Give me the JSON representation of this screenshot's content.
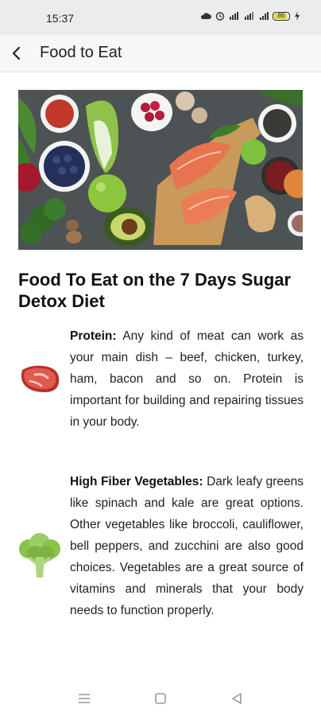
{
  "status_bar": {
    "time": "15:37",
    "battery": "86",
    "icons": [
      "cloud-icon",
      "alarm-icon",
      "hd-signal-icon",
      "wifi-signal-icon",
      "cell-signal-icon",
      "battery-icon",
      "charging-icon"
    ]
  },
  "app_bar": {
    "title": "Food to Eat",
    "back_icon": "chevron-left-icon"
  },
  "article": {
    "title": "Food To Eat on the 7 Days Sugar Detox Diet",
    "sections": [
      {
        "label": "Protein:",
        "text": " Any kind of meat can work as your main dish – beef, chicken, turkey, ham, bacon and so on. Protein is important for building and repairing tissues in your body.",
        "icon": "steak-icon"
      },
      {
        "label": "High Fiber Vegetables:",
        "text": " Dark leafy greens like spinach and kale are great options. Other vegetables like broccoli, cauliflower, bell peppers, and zucchini are also good choices. Vegetables are a great source of vitamins and minerals that your body needs to function properly.",
        "icon": "broccoli-icon"
      }
    ]
  },
  "nav_bar": {
    "icons": [
      "menu-icon",
      "home-square-icon",
      "back-triangle-icon"
    ]
  },
  "colors": {
    "status_bg": "#ececec",
    "app_bar_bg": "#f7f7f7",
    "steak": "#c0392b",
    "broccoli": "#8bc34a"
  }
}
